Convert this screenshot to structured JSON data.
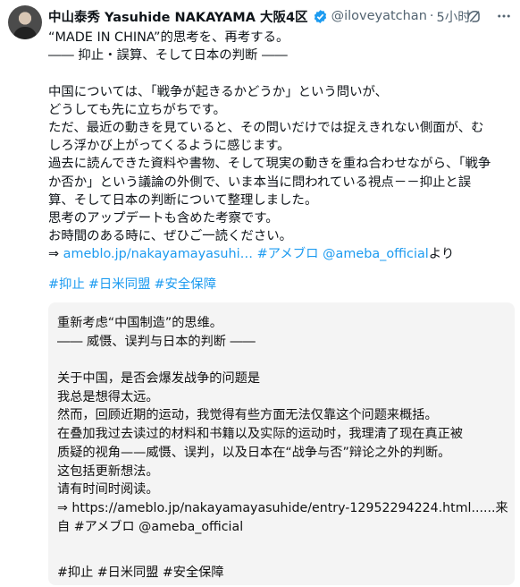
{
  "header": {
    "name": "中山泰秀 Yasuhide NAKAYAMA 大阪4区",
    "handle": "@iloveyatchan",
    "separator": "·",
    "time": "5小时",
    "verified_color": "#1d9bf0"
  },
  "icons": {
    "avatar": "profile-photo",
    "verified": "verified-badge-icon",
    "action1": "grok-icon",
    "action2": "more-icon"
  },
  "post": {
    "lines": [
      "“MADE IN CHINA”的思考を、再考する。",
      "―― 抑止・誤算、そして日本の判断 ――",
      "",
      "中国については、「戦争が起きるかどうか」という問いが、",
      "どうしても先に立ちがちです。",
      "ただ、最近の動きを見ていると、その問いだけでは捉えきれない側面が、む",
      "しろ浮かび上がってくるように感じます。",
      "過去に読んできた資料や書物、そして現実の動きを重ね合わせながら、「戦争",
      "か否か」という議論の外側で、いま本当に問われている視点－－抑止と誤",
      "算、そして日本の判断について整理しました。",
      "思考のアップデートも含めた考察です。",
      "お時間のある時に、ぜひご一読ください。"
    ],
    "link_prefix": "⇒ ",
    "link_url": "ameblo.jp/nakayamayasuhi…",
    "link_tag": "#アメブロ",
    "link_mention": "@ameba_official",
    "link_suffix": "より",
    "hashtags": [
      "#抑止",
      "#日米同盟",
      "#安全保障"
    ]
  },
  "translation": {
    "lines": [
      "重新考虑“中国制造”的思维。",
      " ―― 威慑、误判与日本的判断 ――",
      "",
      "关于中国，是否会爆发战争的问题是",
      "我总是想得太远。",
      "然而，回顾近期的运动，我觉得有些方面无法仅靠这个问题来概括。",
      "在叠加我过去读过的材料和书籍以及实际的运动时，我理清了现在真正被",
      "质疑的视角——威慑、误判，以及日本在“战争与否”辩论之外的判断。",
      "这包括更新想法。",
      "请有时间时阅读。",
      "⇒ https://ameblo.jp/nakayamayasuhide/entry-12952294224.html......来",
      "自 #アメブロ @ameba_official",
      ""
    ],
    "hashtags_line": "#抑止 #日米同盟 #安全保障"
  }
}
